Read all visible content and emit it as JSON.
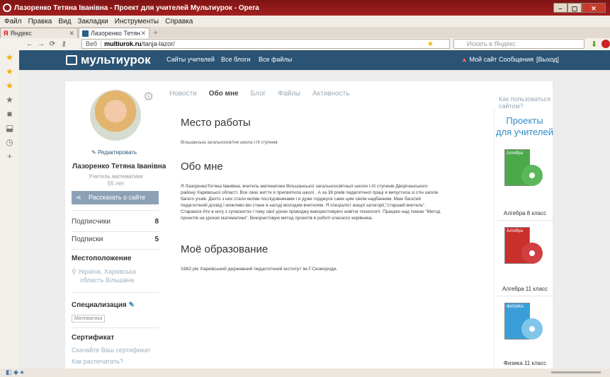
{
  "window": {
    "title": "Лазоренко Тетяна Іванівна - Проект для учителей Мультиурок - Opera",
    "buttons": [
      "–",
      "▢",
      "✕"
    ]
  },
  "menubar": [
    "Файл",
    "Правка",
    "Вид",
    "Закладки",
    "Инструменты",
    "Справка"
  ],
  "tabs": [
    {
      "label": "Яндекс",
      "close": "✕"
    },
    {
      "label": "Лазоренко Тетяна Иван...",
      "close": "✕"
    }
  ],
  "newtab": "+",
  "nav": {
    "back": "←",
    "forward": "→",
    "reload": "⟳",
    "key": "⚷",
    "web_label": "Веб",
    "url_host": "multiurok.ru",
    "url_path": "/tanja-lazor/",
    "search_placeholder": "Искать в Яндекс"
  },
  "site": {
    "logo": "мультиурок",
    "nav_links": [
      "Сайты учителей",
      "Все блоги",
      "Все файлы"
    ],
    "right_links": [
      "Мой сайт",
      "Сообщения",
      "[Выход]"
    ],
    "colors": {
      "header": "#2a5374",
      "accent": "#2f8ec8"
    }
  },
  "profile": {
    "edit": "Редактировать",
    "name": "Лазоренко Тетяна Іванівна",
    "role_line1": "Учитель математики",
    "role_line2": "55 лет",
    "share": "Рассказать о сайте",
    "subscribers_label": "Подписчики",
    "subscribers": "8",
    "subscriptions_label": "Подписки",
    "subscriptions": "5",
    "location_head": "Местоположение",
    "location1": "Україна, Харківська",
    "location2": "область Вільшана",
    "spec_head": "Специализация",
    "spec_badge": "Математика",
    "cert_head": "Сертификат",
    "cert_link1": "Скачайте Ваш сертификат",
    "cert_link2": "Как распечатать?"
  },
  "content_tabs": [
    "Новости",
    "Обо мне",
    "Блог",
    "Файлы",
    "Активность"
  ],
  "howto": "Как пользоваться сайтом?",
  "main": {
    "work_title": "Место работы",
    "work_text": "Вільшанська загальноосвітня школа І-ІІІ ступенів",
    "about_title": "Обо мне",
    "about_text": "Я ЛазоренкоТетяна Іванівна, вчитель математики Вільшанської загальноосвітньої школи І-ІІІ ступенів Дворічанського району Харківської області. Все своє життя я присвятила школі . А за 38 років педагогічної праці я випустила зі стін школи багато учнів. Дехто з них стали моїми послідовниками і я дуже горджуся саме цим своїм надбанням. Маю багатий педагогічний досвід і можливо він стане в нагоді молодим вчителям. Я спеціаліст вищої категорії,\"старший вчитель\". Стараюся йти в ногу з сучасністю і тому свої уроки проводжу використовуючі новітні технології. Працюю над темою \"Метод проектів на уроках математики\". Використовую метод проектів в роботі класного керівника.",
    "edu_title": "Моё образование",
    "edu_text": "1982 рік Харківський державний педагогічний інститут ім.Г.Сковороди."
  },
  "sidebar_right": {
    "title1": "Проекты",
    "title2": "для учителей",
    "products": [
      {
        "label": "Алгебра 8 класс",
        "box_text": "Алгебра"
      },
      {
        "label": "Алгебра 11 класс",
        "box_text": "Алгебра"
      },
      {
        "label": "Физика 11 класс",
        "box_text": "ФИЗИКА"
      }
    ]
  }
}
